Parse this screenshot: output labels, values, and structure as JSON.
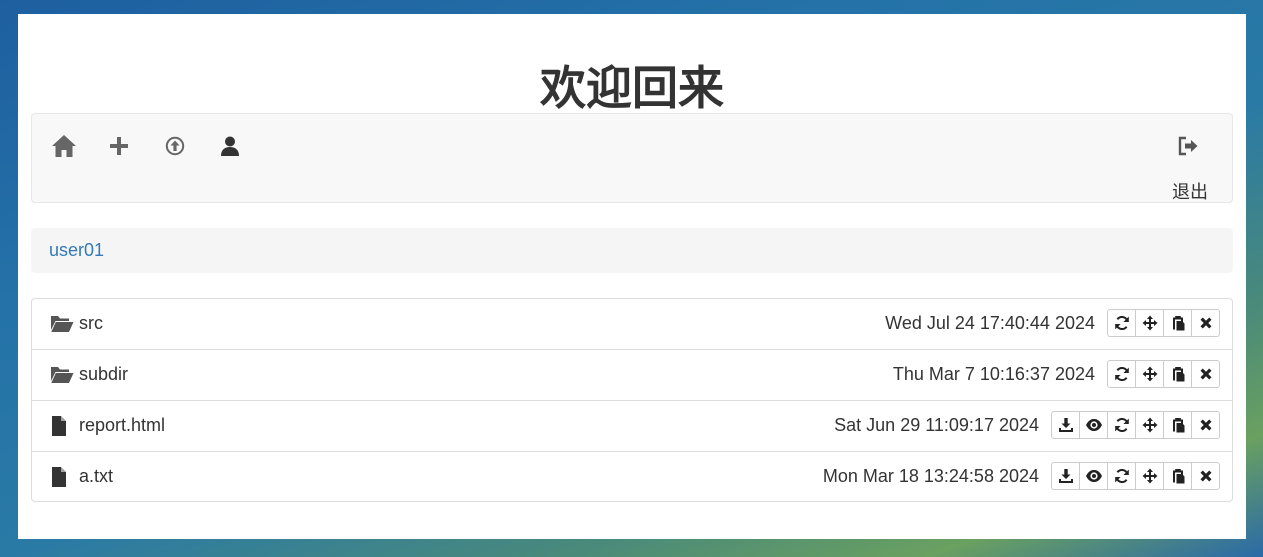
{
  "page": {
    "title": "欢迎回来"
  },
  "navbar": {
    "icons": [
      "home-icon",
      "plus-icon",
      "upload-icon",
      "user-icon"
    ],
    "logout_icon": "logout-icon",
    "logout_label": "退出"
  },
  "breadcrumb": {
    "path": "user01"
  },
  "files": [
    {
      "type": "folder",
      "name": "src",
      "date": "Wed Jul 24 17:40:44 2024",
      "actions": [
        "refresh-icon",
        "move-icon",
        "paste-icon",
        "delete-icon"
      ]
    },
    {
      "type": "folder",
      "name": "subdir",
      "date": "Thu Mar 7 10:16:37 2024",
      "actions": [
        "refresh-icon",
        "move-icon",
        "paste-icon",
        "delete-icon"
      ]
    },
    {
      "type": "file",
      "name": "report.html",
      "date": "Sat Jun 29 11:09:17 2024",
      "actions": [
        "download-icon",
        "eye-icon",
        "refresh-icon",
        "move-icon",
        "paste-icon",
        "delete-icon"
      ]
    },
    {
      "type": "file",
      "name": "a.txt",
      "date": "Mon Mar 18 13:24:58 2024",
      "actions": [
        "download-icon",
        "eye-icon",
        "refresh-icon",
        "move-icon",
        "paste-icon",
        "delete-icon"
      ]
    }
  ]
}
